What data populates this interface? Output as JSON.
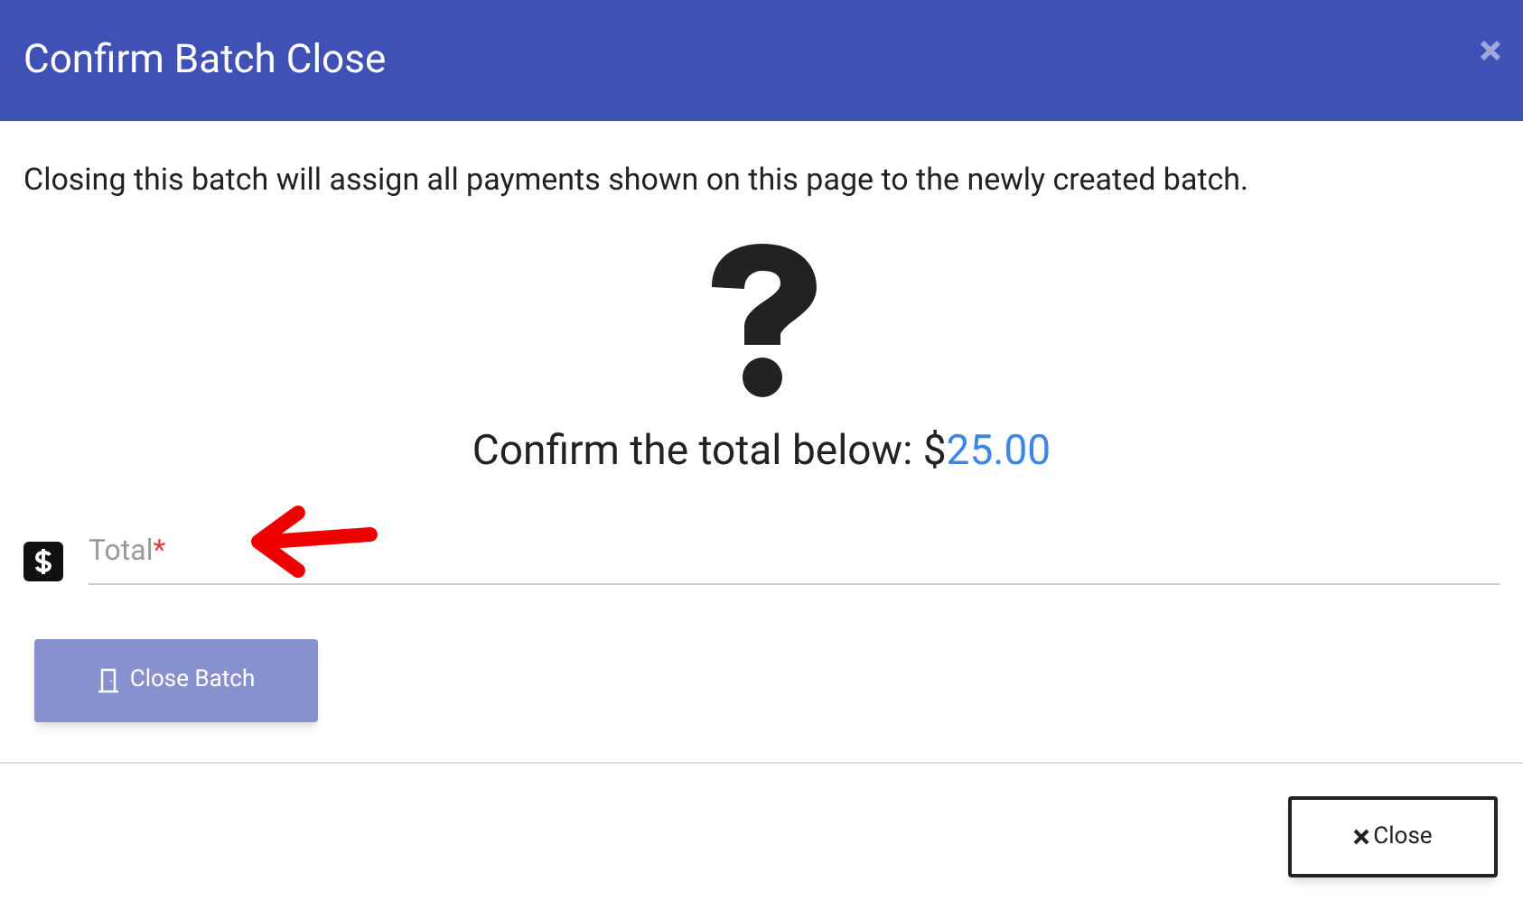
{
  "dialog": {
    "title": "Confirm Batch Close"
  },
  "message": "Closing this batch will assign all payments shown on this page to the newly created batch.",
  "confirm": {
    "prefix": "Confirm the total below: $",
    "amount": "25.00"
  },
  "field": {
    "placeholder": "Total",
    "required_mark": "*",
    "required": true
  },
  "primary_button": {
    "label": "Close Batch",
    "disabled": true
  },
  "footer_button": {
    "label": "Close"
  }
}
